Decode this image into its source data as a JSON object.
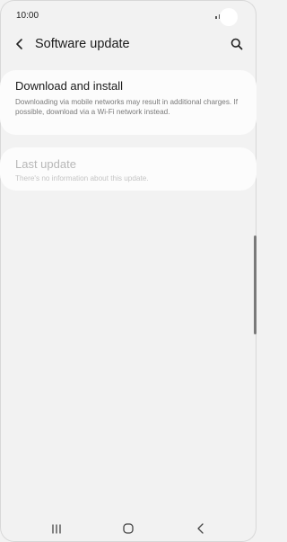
{
  "status_bar": {
    "time": "10:00"
  },
  "header": {
    "title": "Software update",
    "back_icon": "chevron-left-icon",
    "search_icon": "search-icon"
  },
  "items": [
    {
      "title": "Download and install",
      "description": "Downloading via mobile networks may result in additional charges. If possible, download via a Wi-Fi network instead.",
      "enabled": true
    },
    {
      "title": "Last update",
      "description": "There's no information about this update.",
      "enabled": false
    }
  ],
  "nav_bar": {
    "recent_icon": "recent-apps-icon",
    "home_icon": "home-icon",
    "back_icon": "back-icon"
  },
  "colors": {
    "background": "#f2f2f2",
    "card": "#fcfcfc",
    "disabled_text": "#b7b7b7"
  }
}
